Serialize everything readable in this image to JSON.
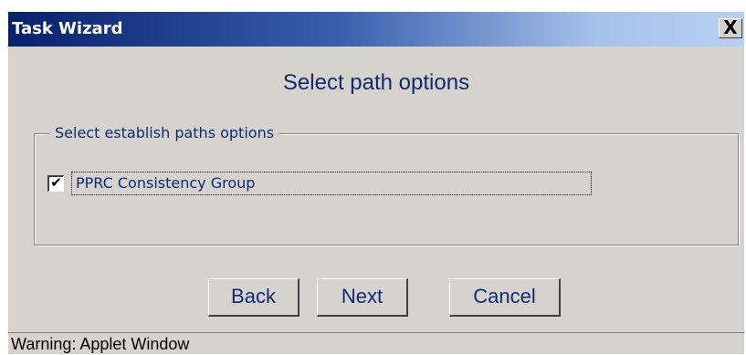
{
  "window": {
    "title": "Task Wizard",
    "close_glyph": "X"
  },
  "heading": "Select path options",
  "group": {
    "legend": "Select establish paths options",
    "option": {
      "label": "PPRC Consistency Group",
      "checked": true,
      "check_glyph": "✔"
    }
  },
  "buttons": {
    "back": "Back",
    "next": "Next",
    "cancel": "Cancel"
  },
  "status": "Warning: Applet Window",
  "colors": {
    "titlebar_start": "#08216b",
    "titlebar_end": "#b8d0f2",
    "panel": "#d6d3ce",
    "text_blue": "#102a70"
  }
}
